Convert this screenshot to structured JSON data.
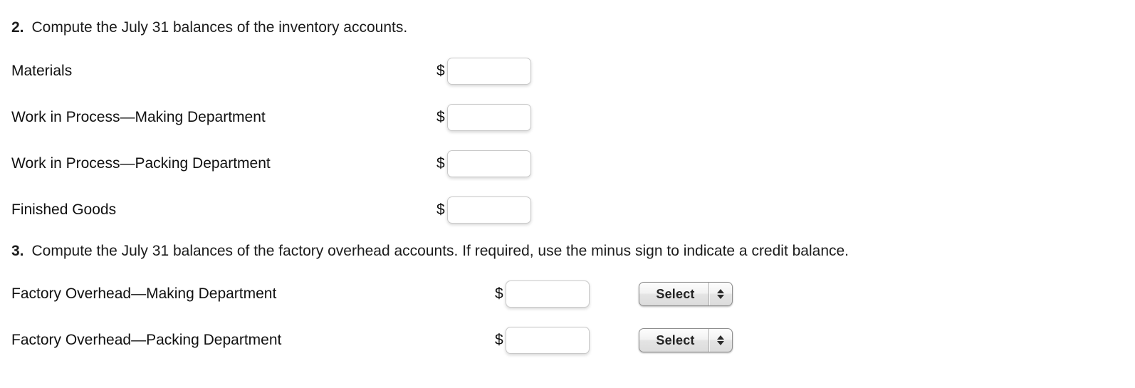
{
  "page": {
    "background": "#ffffff"
  },
  "questions": [
    {
      "number": "2.",
      "text": "Compute the July 31 balances of the inventory accounts."
    },
    {
      "number": "3.",
      "text": "Compute the July 31 balances of the factory overhead accounts. If required, use the minus sign to indicate a credit balance."
    }
  ],
  "inventory_rows": [
    {
      "label": "Materials",
      "currency": "$",
      "value": "",
      "placeholder": ""
    },
    {
      "label": "Work in Process—Making Department",
      "currency": "$",
      "value": "",
      "placeholder": ""
    },
    {
      "label": "Work in Process—Packing Department",
      "currency": "$",
      "value": "",
      "placeholder": ""
    },
    {
      "label": "Finished Goods",
      "currency": "$",
      "value": "",
      "placeholder": ""
    }
  ],
  "overhead_rows": [
    {
      "label": "Factory Overhead—Making Department",
      "currency": "$",
      "value": "",
      "placeholder": "",
      "select_label": "Select"
    },
    {
      "label": "Factory Overhead—Packing Department",
      "currency": "$",
      "value": "",
      "placeholder": "",
      "select_label": "Select"
    }
  ],
  "icons": {
    "stepper_up": "up-triangle-icon",
    "stepper_down": "down-triangle-icon"
  }
}
